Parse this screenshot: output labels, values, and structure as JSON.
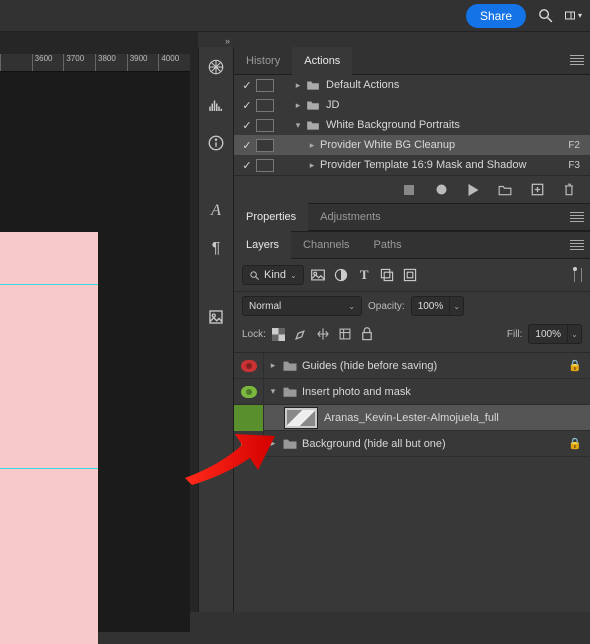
{
  "topbar": {
    "share_label": "Share"
  },
  "ruler": {
    "ticks": [
      "",
      "3600",
      "3700",
      "3800",
      "3900",
      "4000"
    ]
  },
  "actions_panel": {
    "tabs": {
      "history": "History",
      "actions": "Actions"
    },
    "rows": [
      {
        "checked": true,
        "btn": true,
        "disclose": "right",
        "icon": "folder",
        "label": "Default Actions",
        "indent": 0
      },
      {
        "checked": true,
        "btn": false,
        "disclose": "right",
        "icon": "folder",
        "label": "JD",
        "indent": 0
      },
      {
        "checked": true,
        "btn": false,
        "disclose": "down",
        "icon": "folder",
        "label": "White Background Portraits",
        "indent": 0
      },
      {
        "checked": true,
        "btn": false,
        "disclose": "right",
        "icon": "",
        "label": "Provider White BG Cleanup",
        "shortcut": "F2",
        "indent": 1,
        "selected": true
      },
      {
        "checked": true,
        "btn": false,
        "disclose": "right",
        "icon": "",
        "label": "Provider Template 16:9 Mask and Shadow",
        "shortcut": "F3",
        "indent": 1
      }
    ]
  },
  "properties_panel": {
    "tabs": {
      "properties": "Properties",
      "adjustments": "Adjustments"
    }
  },
  "layers_panel": {
    "tabs": {
      "layers": "Layers",
      "channels": "Channels",
      "paths": "Paths"
    },
    "filter": {
      "kind_label": "Kind"
    },
    "blend": {
      "mode": "Normal",
      "opacity_label": "Opacity:",
      "opacity_value": "100%"
    },
    "lock": {
      "lock_label": "Lock:",
      "fill_label": "Fill:",
      "fill_value": "100%"
    },
    "rows": [
      {
        "eye": "red",
        "disclose": "right",
        "thumb": "folder",
        "label": "Guides (hide before saving)",
        "locked": true
      },
      {
        "eye": "green",
        "disclose": "down",
        "thumb": "folder",
        "label": "Insert photo and mask"
      },
      {
        "eye": "none",
        "disclose": "",
        "thumb": "image",
        "label": "Aranas_Kevin-Lester-Almojuela_full",
        "indent": true,
        "selected": true
      },
      {
        "eye": "green",
        "disclose": "right",
        "thumb": "folder",
        "label": "Background (hide all but one)",
        "locked": true
      }
    ]
  }
}
